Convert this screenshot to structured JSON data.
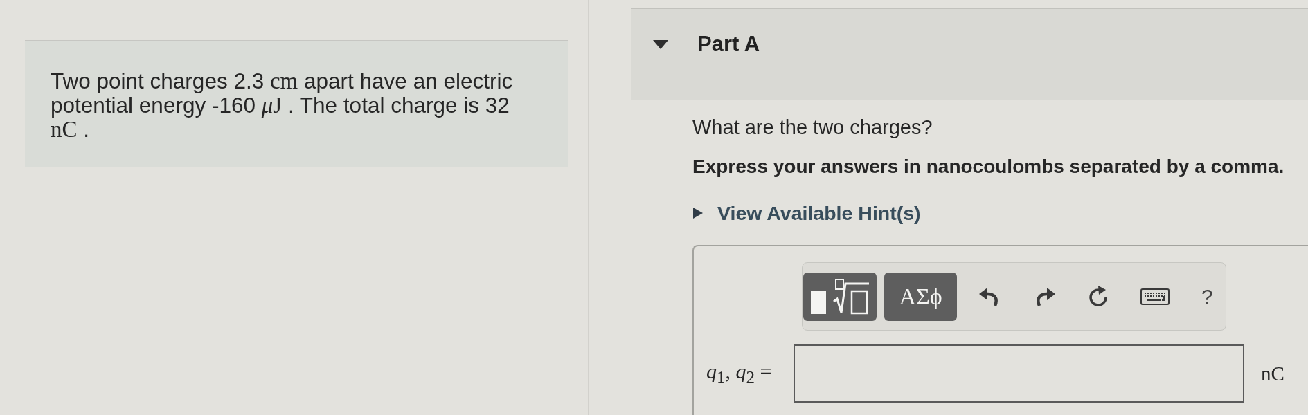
{
  "problem": {
    "segments": [
      {
        "kind": "text",
        "text": "Two point charges 2.3 "
      },
      {
        "kind": "math",
        "text": "cm"
      },
      {
        "kind": "text",
        "text": " apart have an electric potential energy -160 "
      },
      {
        "kind": "math",
        "text": "*μ*"
      },
      {
        "kind": "math",
        "text": "J"
      },
      {
        "kind": "text",
        "text": " . The total charge is 32 "
      },
      {
        "kind": "math",
        "text": "nC"
      },
      {
        "kind": "text",
        "text": " ."
      }
    ]
  },
  "part": {
    "title": "Part A",
    "expanded": true,
    "question": "What are the two charges?",
    "instruction": "Express your answers in nanocoulombs separated by a comma.",
    "hint": {
      "label": "View Available Hint(s)",
      "expanded": false
    },
    "toolbar": [
      {
        "kind": "templates"
      },
      {
        "kind": "symbols",
        "label": "ΑΣϕ"
      },
      {
        "kind": "undo"
      },
      {
        "kind": "redo"
      },
      {
        "kind": "reset"
      },
      {
        "kind": "keyboard"
      },
      {
        "kind": "help",
        "label": "?"
      }
    ],
    "answer": {
      "label": "*q*$_{1}$, *q*$_{2}$ =",
      "unit": "nC"
    }
  }
}
